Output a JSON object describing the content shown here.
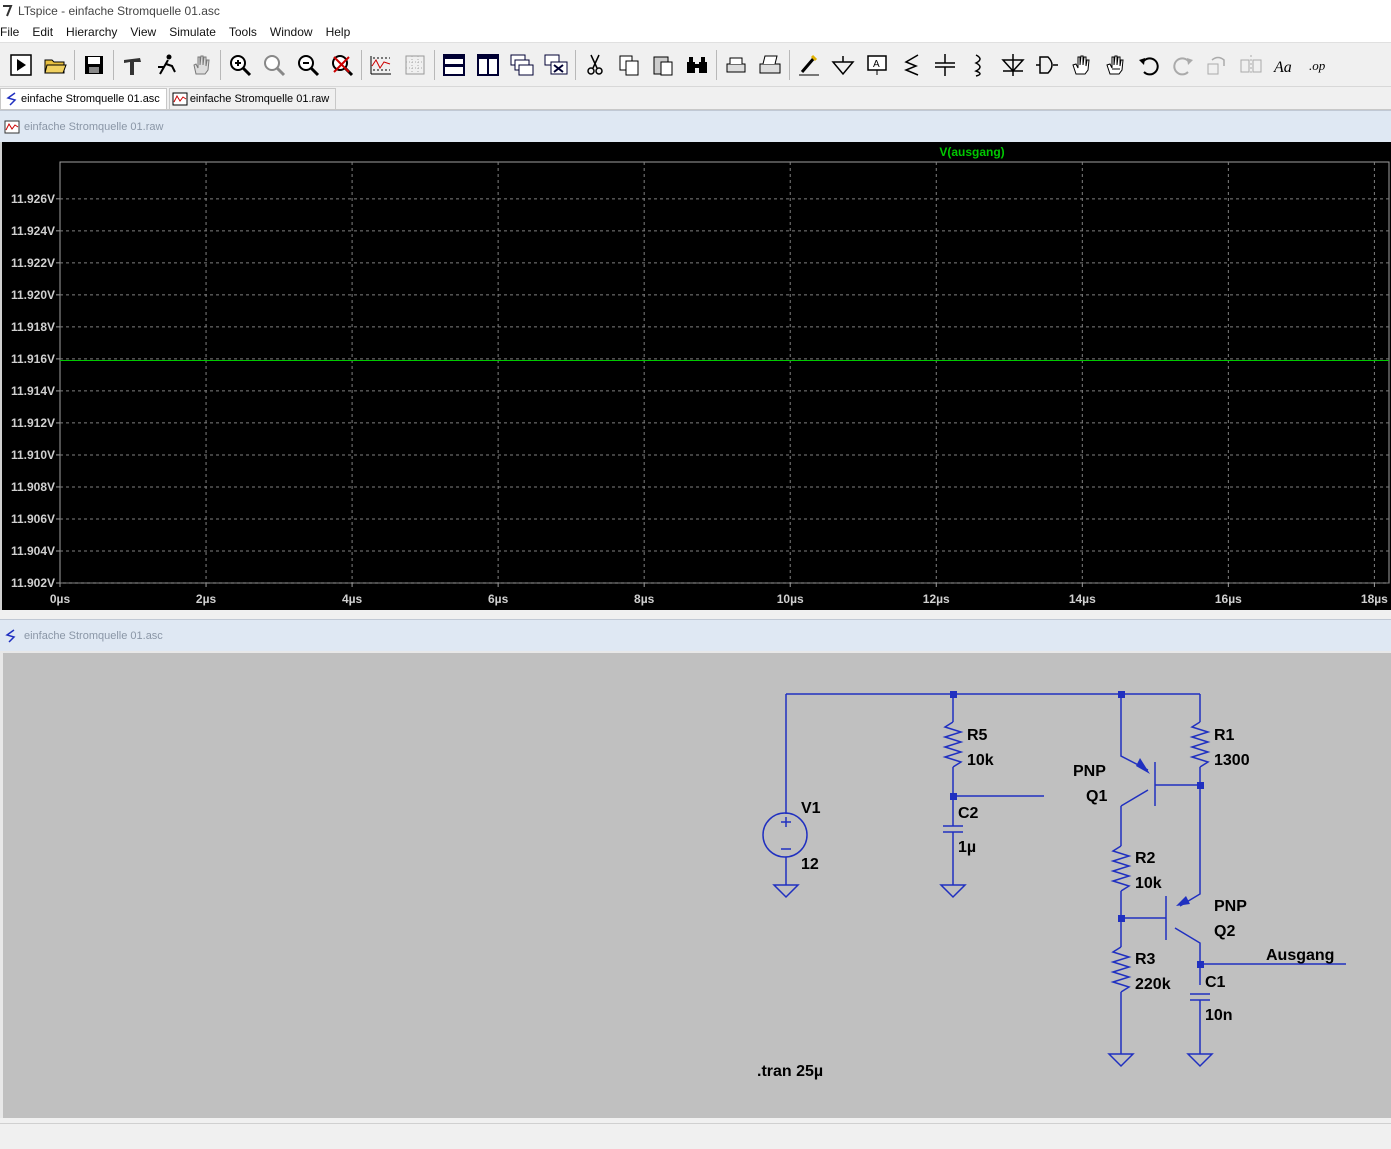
{
  "window": {
    "app_icon": "ltspice-icon",
    "title": "LTspice - einfache Stromquelle 01.asc"
  },
  "menu": [
    "File",
    "Edit",
    "Hierarchy",
    "View",
    "Simulate",
    "Tools",
    "Window",
    "Help"
  ],
  "toolbar": {
    "buttons": [
      "run-icon",
      "open-icon",
      "save-icon",
      "control-panel-icon",
      "halt-icon",
      "pan-hand-icon",
      "zoom-in-icon",
      "zoom-area-icon",
      "zoom-out-icon",
      "zoom-fit-icon",
      "autorange-icon",
      "grid-icon",
      "tile-horizontal-icon",
      "tile-vertical-icon",
      "cascade-icon",
      "close-all-icon",
      "cut-icon",
      "copy-icon",
      "paste-icon",
      "find-icon",
      "print-preview-icon",
      "print-icon",
      "wire-icon",
      "ground-icon",
      "label-net-icon",
      "resistor-icon",
      "capacitor-icon",
      "inductor-icon",
      "diode-icon",
      "component-icon",
      "move-icon",
      "drag-icon",
      "undo-icon",
      "redo-icon",
      "rotate-icon",
      "mirror-icon",
      "text-icon",
      "spice-directive-icon"
    ]
  },
  "doc_tabs": [
    {
      "label": "einfache Stromquelle 01.asc",
      "icon": "schematic-icon",
      "active": true
    },
    {
      "label": "einfache Stromquelle 01.raw",
      "icon": "waveform-icon",
      "active": false
    }
  ],
  "waveform_pane": {
    "title": "einfache Stromquelle 01.raw",
    "icon": "waveform-icon"
  },
  "schematic_pane": {
    "title": "einfache Stromquelle 01.asc",
    "icon": "schematic-icon"
  },
  "chart_data": {
    "type": "line",
    "series": [
      {
        "name": "V(ausgang)",
        "color": "#00c800",
        "x": [
          0,
          18.2
        ],
        "y": [
          11.9159,
          11.9159
        ]
      }
    ],
    "x_ticks": [
      "0µs",
      "2µs",
      "4µs",
      "6µs",
      "8µs",
      "10µs",
      "12µs",
      "14µs",
      "16µs",
      "18µs"
    ],
    "x_tick_values": [
      0,
      2,
      4,
      6,
      8,
      10,
      12,
      14,
      16,
      18
    ],
    "y_ticks": [
      "11.902V",
      "11.904V",
      "11.906V",
      "11.908V",
      "11.910V",
      "11.912V",
      "11.914V",
      "11.916V",
      "11.918V",
      "11.920V",
      "11.922V",
      "11.924V",
      "11.926V"
    ],
    "y_tick_values": [
      11.902,
      11.904,
      11.906,
      11.908,
      11.91,
      11.912,
      11.914,
      11.916,
      11.918,
      11.92,
      11.922,
      11.924,
      11.926
    ],
    "xlim": [
      0,
      18.2
    ],
    "ylim": [
      11.902,
      11.9283
    ],
    "grid": true,
    "background": "#000000",
    "grid_color": "#808080",
    "tick_label_color": "#d0d0d0",
    "legend_placement": "top"
  },
  "schematic": {
    "wire_color": "#2030c0",
    "components": [
      {
        "ref": "V1",
        "value": "12"
      },
      {
        "ref": "R5",
        "value": "10k"
      },
      {
        "ref": "C2",
        "value": "1µ"
      },
      {
        "ref": "R1",
        "value": "1300"
      },
      {
        "ref": "Q1",
        "model": "PNP"
      },
      {
        "ref": "R2",
        "value": "10k"
      },
      {
        "ref": "Q2",
        "model": "PNP"
      },
      {
        "ref": "R3",
        "value": "220k"
      },
      {
        "ref": "C1",
        "value": "10n"
      }
    ],
    "net_label": "Ausgang",
    "directive": ".tran 25µ"
  }
}
